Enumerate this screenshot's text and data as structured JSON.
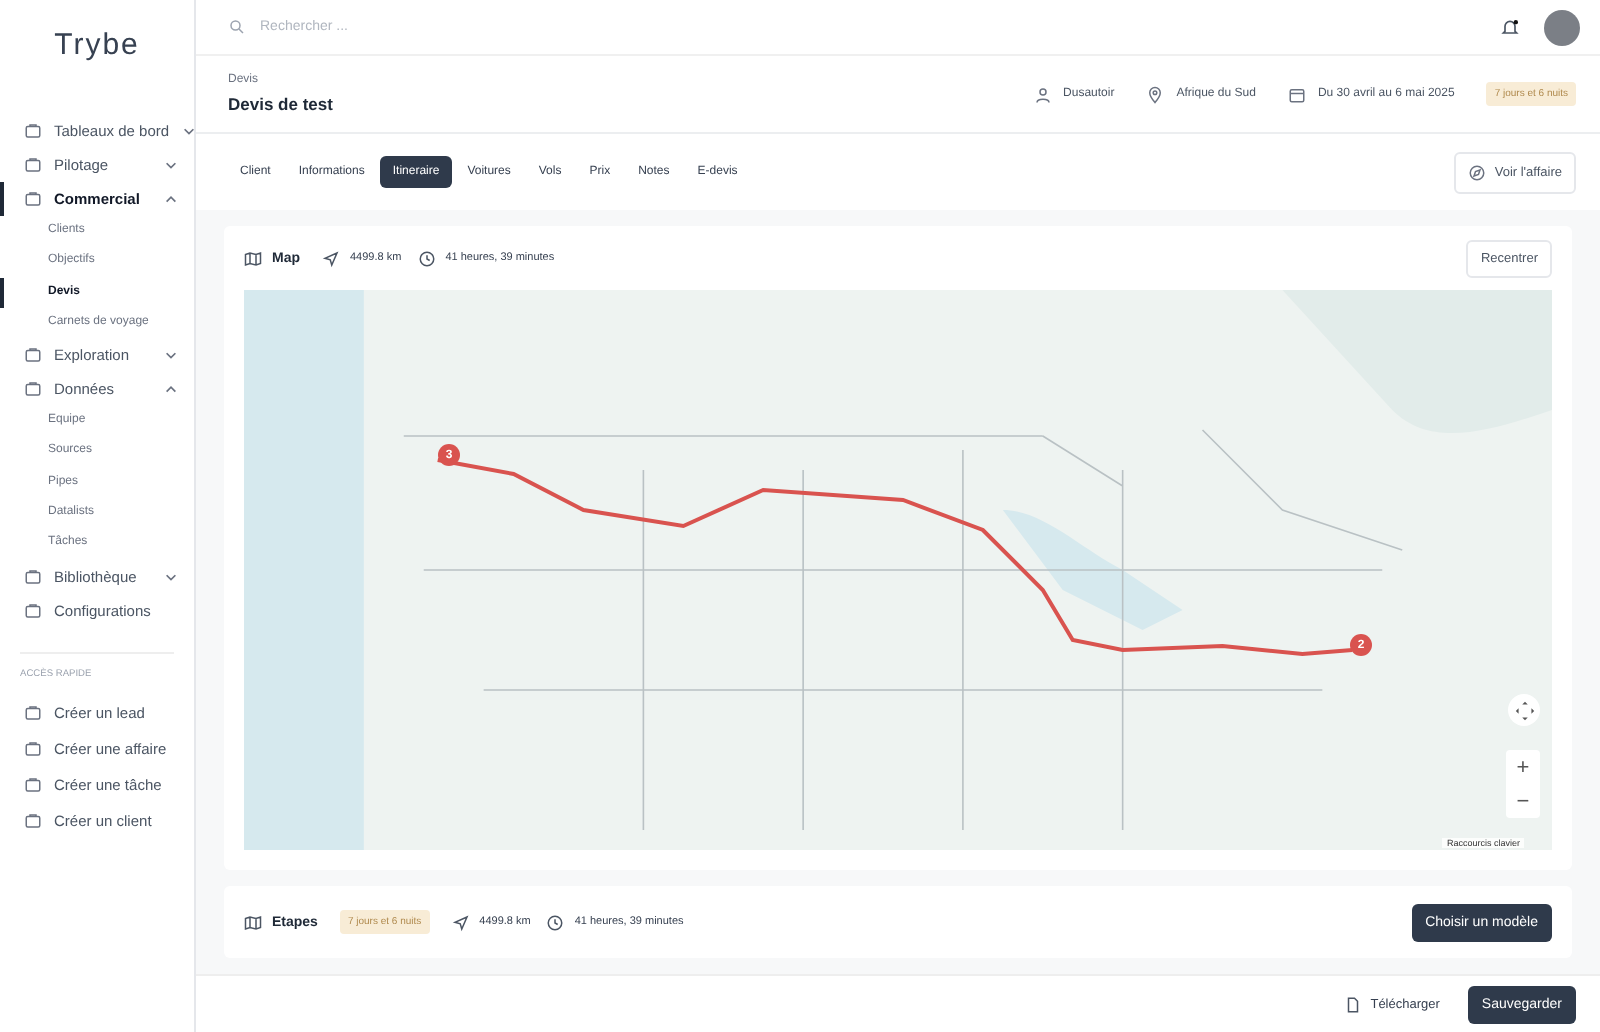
{
  "brand": {
    "name": "Trybe"
  },
  "sidebar": {
    "items": [
      {
        "label": "Tableaux de bord",
        "expanded": false,
        "selected": false
      },
      {
        "label": "Pilotage",
        "expanded": false,
        "selected": false
      },
      {
        "label": "Commercial",
        "expanded": true,
        "selected": true,
        "children": [
          {
            "label": "Clients",
            "selected": false
          },
          {
            "label": "Objectifs",
            "selected": false
          },
          {
            "label": "Devis",
            "selected": true
          },
          {
            "label": "Carnets de voyage",
            "selected": false
          }
        ]
      },
      {
        "label": "Exploration",
        "expanded": false,
        "selected": false
      },
      {
        "label": "Données",
        "expanded": true,
        "selected": false,
        "children": [
          {
            "label": "Equipe",
            "selected": false
          },
          {
            "label": "Sources",
            "selected": false
          },
          {
            "label": "Pipes",
            "selected": false
          },
          {
            "label": "Datalists",
            "selected": false
          },
          {
            "label": "Tâches",
            "selected": false
          }
        ]
      },
      {
        "label": "Bibliothèque",
        "expanded": false,
        "selected": false
      },
      {
        "label": "Configurations",
        "expandable": false,
        "selected": false
      }
    ],
    "quick_title": "ACCÈS RAPIDE",
    "quick_items": [
      "Créer un lead",
      "Créer une affaire",
      "Créer une tâche",
      "Créer un client"
    ]
  },
  "search": {
    "placeholder": "Rechercher ..."
  },
  "header": {
    "breadcrumb": "Devis",
    "title": "Devis de test",
    "owner": "Dusautoir",
    "destination": "Afrique du Sud",
    "dates": "Du 30 avril au 6 mai 2025",
    "duration": "7 jours et 6 nuits"
  },
  "tabs": [
    {
      "label": "Client",
      "selected": false
    },
    {
      "label": "Informations",
      "selected": false
    },
    {
      "label": "Itineraire",
      "selected": true
    },
    {
      "label": "Voitures",
      "selected": false
    },
    {
      "label": "Vols",
      "selected": false
    },
    {
      "label": "Prix",
      "selected": false
    },
    {
      "label": "Notes",
      "selected": false
    },
    {
      "label": "E-devis",
      "selected": false
    }
  ],
  "view_deal_button": "Voir l'affaire",
  "map_card": {
    "title": "Map",
    "distance": "4499.8 km",
    "time": "41 heures, 39 minutes",
    "recenter_button": "Recentrer",
    "pins": [
      "3",
      "2"
    ],
    "zoom_in": "+",
    "zoom_out": "−",
    "shortcuts": "Raccourcis clavier"
  },
  "steps_card": {
    "title": "Etapes",
    "duration": "7 jours et 6 nuits",
    "distance": "4499.8 km",
    "time": "41 heures, 39 minutes",
    "model_button": "Choisir un modèle"
  },
  "footer": {
    "download_button": "Télécharger",
    "save_button": "Sauvegarder"
  }
}
